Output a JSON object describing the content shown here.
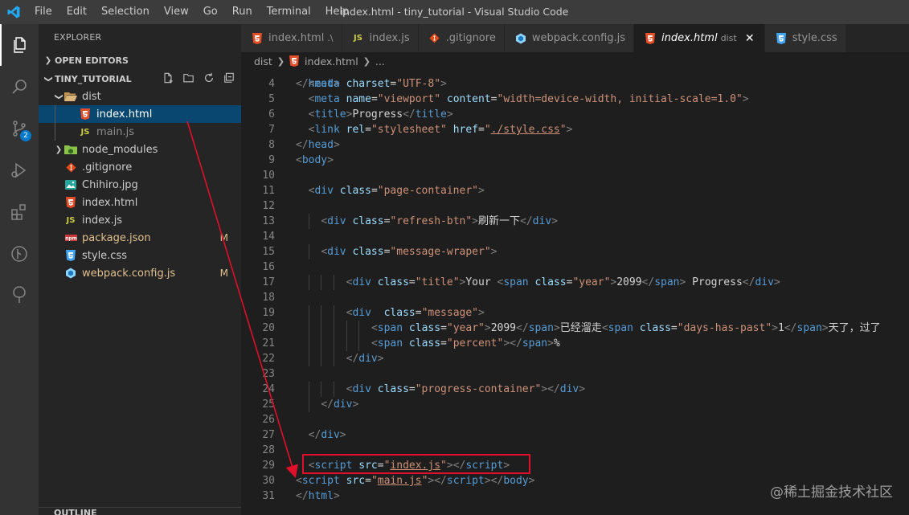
{
  "window_title": "index.html - tiny_tutorial - Visual Studio Code",
  "menu": [
    "File",
    "Edit",
    "Selection",
    "View",
    "Go",
    "Run",
    "Terminal",
    "Help"
  ],
  "activity_badge": "2",
  "sidebar": {
    "title": "EXPLORER",
    "open_editors": "OPEN EDITORS",
    "project": "TINY_TUTORIAL",
    "outline": "OUTLINE",
    "tree": [
      {
        "label": "dist",
        "type": "folder-open",
        "depth": 1
      },
      {
        "label": "index.html",
        "type": "html",
        "depth": 2,
        "selected": true
      },
      {
        "label": "main.js",
        "type": "js",
        "depth": 2,
        "dim": true
      },
      {
        "label": "node_modules",
        "type": "folder",
        "depth": 1
      },
      {
        "label": ".gitignore",
        "type": "git",
        "depth": 1
      },
      {
        "label": "Chihiro.jpg",
        "type": "image",
        "depth": 1
      },
      {
        "label": "index.html",
        "type": "html",
        "depth": 1
      },
      {
        "label": "index.js",
        "type": "js",
        "depth": 1
      },
      {
        "label": "package.json",
        "type": "json",
        "depth": 1,
        "modified": true,
        "status": "M"
      },
      {
        "label": "style.css",
        "type": "css",
        "depth": 1
      },
      {
        "label": "webpack.config.js",
        "type": "webpack",
        "depth": 1,
        "modified": true,
        "status": "M"
      }
    ]
  },
  "tabs": [
    {
      "label": "index.html",
      "desc": ".\\",
      "type": "html"
    },
    {
      "label": "index.js",
      "desc": "",
      "type": "js"
    },
    {
      "label": ".gitignore",
      "desc": "",
      "type": "git"
    },
    {
      "label": "webpack.config.js",
      "desc": "",
      "type": "webpack"
    },
    {
      "label": "index.html",
      "desc": "dist",
      "type": "html",
      "active": true
    },
    {
      "label": "style.css",
      "desc": "",
      "type": "css"
    }
  ],
  "breadcrumb": {
    "folder": "dist",
    "file": "index.html",
    "more": "..."
  },
  "editor": {
    "lines": [
      {
        "n": "4",
        "indent": 1,
        "tokens": [
          [
            "br",
            "<"
          ],
          [
            "tag",
            "meta"
          ],
          [
            "txt",
            " "
          ],
          [
            "attr",
            "charset"
          ],
          [
            "txt",
            "="
          ],
          [
            "str",
            "\"UTF-8\""
          ],
          [
            "br",
            ">"
          ]
        ]
      },
      {
        "n": "5",
        "indent": 1,
        "tokens": [
          [
            "br",
            "<"
          ],
          [
            "tag",
            "meta"
          ],
          [
            "txt",
            " "
          ],
          [
            "attr",
            "name"
          ],
          [
            "txt",
            "="
          ],
          [
            "str",
            "\"viewport\""
          ],
          [
            "txt",
            " "
          ],
          [
            "attr",
            "content"
          ],
          [
            "txt",
            "="
          ],
          [
            "str",
            "\"width=device-width, initial-scale=1.0\""
          ],
          [
            "br",
            ">"
          ]
        ]
      },
      {
        "n": "6",
        "indent": 1,
        "tokens": [
          [
            "br",
            "<"
          ],
          [
            "tag",
            "title"
          ],
          [
            "br",
            ">"
          ],
          [
            "txt",
            "Progress"
          ],
          [
            "br",
            "</"
          ],
          [
            "tag",
            "title"
          ],
          [
            "br",
            ">"
          ]
        ]
      },
      {
        "n": "7",
        "indent": 1,
        "tokens": [
          [
            "br",
            "<"
          ],
          [
            "tag",
            "link"
          ],
          [
            "txt",
            " "
          ],
          [
            "attr",
            "rel"
          ],
          [
            "txt",
            "="
          ],
          [
            "str",
            "\"stylesheet\""
          ],
          [
            "txt",
            " "
          ],
          [
            "attr",
            "href"
          ],
          [
            "txt",
            "="
          ],
          [
            "str",
            "\""
          ],
          [
            "strlink",
            "./style.css"
          ],
          [
            "str",
            "\""
          ],
          [
            "br",
            ">"
          ]
        ]
      },
      {
        "n": "8",
        "indent": 0,
        "tokens": [
          [
            "br",
            "</"
          ],
          [
            "tag",
            "head"
          ],
          [
            "br",
            ">"
          ]
        ]
      },
      {
        "n": "9",
        "indent": 0,
        "tokens": [
          [
            "br",
            "<"
          ],
          [
            "tag",
            "body"
          ],
          [
            "br",
            ">"
          ]
        ]
      },
      {
        "n": "10",
        "indent": 0,
        "tokens": []
      },
      {
        "n": "11",
        "indent": 1,
        "tokens": [
          [
            "br",
            "<"
          ],
          [
            "tag",
            "div"
          ],
          [
            "txt",
            " "
          ],
          [
            "attr",
            "class"
          ],
          [
            "txt",
            "="
          ],
          [
            "str",
            "\"page-container\""
          ],
          [
            "br",
            ">"
          ]
        ]
      },
      {
        "n": "12",
        "indent": 0,
        "tokens": []
      },
      {
        "n": "13",
        "indent": 2,
        "tokens": [
          [
            "br",
            "<"
          ],
          [
            "tag",
            "div"
          ],
          [
            "txt",
            " "
          ],
          [
            "attr",
            "class"
          ],
          [
            "txt",
            "="
          ],
          [
            "str",
            "\"refresh-btn\""
          ],
          [
            "br",
            ">"
          ],
          [
            "txt",
            "刷新一下"
          ],
          [
            "br",
            "</"
          ],
          [
            "tag",
            "div"
          ],
          [
            "br",
            ">"
          ]
        ]
      },
      {
        "n": "14",
        "indent": 0,
        "tokens": []
      },
      {
        "n": "15",
        "indent": 2,
        "tokens": [
          [
            "br",
            "<"
          ],
          [
            "tag",
            "div"
          ],
          [
            "txt",
            " "
          ],
          [
            "attr",
            "class"
          ],
          [
            "txt",
            "="
          ],
          [
            "str",
            "\"message-wraper\""
          ],
          [
            "br",
            ">"
          ]
        ]
      },
      {
        "n": "16",
        "indent": 0,
        "tokens": []
      },
      {
        "n": "17",
        "indent": 4,
        "tokens": [
          [
            "br",
            "<"
          ],
          [
            "tag",
            "div"
          ],
          [
            "txt",
            " "
          ],
          [
            "attr",
            "class"
          ],
          [
            "txt",
            "="
          ],
          [
            "str",
            "\"title\""
          ],
          [
            "br",
            ">"
          ],
          [
            "txt",
            "Your "
          ],
          [
            "br",
            "<"
          ],
          [
            "tag",
            "span"
          ],
          [
            "txt",
            " "
          ],
          [
            "attr",
            "class"
          ],
          [
            "txt",
            "="
          ],
          [
            "str",
            "\"year\""
          ],
          [
            "br",
            ">"
          ],
          [
            "txt",
            "2099"
          ],
          [
            "br",
            "</"
          ],
          [
            "tag",
            "span"
          ],
          [
            "br",
            ">"
          ],
          [
            "txt",
            " Progress"
          ],
          [
            "br",
            "</"
          ],
          [
            "tag",
            "div"
          ],
          [
            "br",
            ">"
          ]
        ]
      },
      {
        "n": "18",
        "indent": 0,
        "tokens": []
      },
      {
        "n": "19",
        "indent": 4,
        "tokens": [
          [
            "br",
            "<"
          ],
          [
            "tag",
            "div"
          ],
          [
            "txt",
            "  "
          ],
          [
            "attr",
            "class"
          ],
          [
            "txt",
            "="
          ],
          [
            "str",
            "\"message\""
          ],
          [
            "br",
            ">"
          ]
        ]
      },
      {
        "n": "20",
        "indent": 6,
        "tokens": [
          [
            "br",
            "<"
          ],
          [
            "tag",
            "span"
          ],
          [
            "txt",
            " "
          ],
          [
            "attr",
            "class"
          ],
          [
            "txt",
            "="
          ],
          [
            "str",
            "\"year\""
          ],
          [
            "br",
            ">"
          ],
          [
            "txt",
            "2099"
          ],
          [
            "br",
            "</"
          ],
          [
            "tag",
            "span"
          ],
          [
            "br",
            ">"
          ],
          [
            "txt",
            "已经溜走"
          ],
          [
            "br",
            "<"
          ],
          [
            "tag",
            "span"
          ],
          [
            "txt",
            " "
          ],
          [
            "attr",
            "class"
          ],
          [
            "txt",
            "="
          ],
          [
            "str",
            "\"days-has-past\""
          ],
          [
            "br",
            ">"
          ],
          [
            "txt",
            "1"
          ],
          [
            "br",
            "</"
          ],
          [
            "tag",
            "span"
          ],
          [
            "br",
            ">"
          ],
          [
            "txt",
            "天了，过了"
          ]
        ]
      },
      {
        "n": "21",
        "indent": 6,
        "tokens": [
          [
            "br",
            "<"
          ],
          [
            "tag",
            "span"
          ],
          [
            "txt",
            " "
          ],
          [
            "attr",
            "class"
          ],
          [
            "txt",
            "="
          ],
          [
            "str",
            "\"percent\""
          ],
          [
            "br",
            "></"
          ],
          [
            "tag",
            "span"
          ],
          [
            "br",
            ">"
          ],
          [
            "txt",
            "%"
          ]
        ]
      },
      {
        "n": "22",
        "indent": 4,
        "tokens": [
          [
            "br",
            "</"
          ],
          [
            "tag",
            "div"
          ],
          [
            "br",
            ">"
          ]
        ]
      },
      {
        "n": "23",
        "indent": 0,
        "tokens": []
      },
      {
        "n": "24",
        "indent": 4,
        "tokens": [
          [
            "br",
            "<"
          ],
          [
            "tag",
            "div"
          ],
          [
            "txt",
            " "
          ],
          [
            "attr",
            "class"
          ],
          [
            "txt",
            "="
          ],
          [
            "str",
            "\"progress-container\""
          ],
          [
            "br",
            "></"
          ],
          [
            "tag",
            "div"
          ],
          [
            "br",
            ">"
          ]
        ]
      },
      {
        "n": "25",
        "indent": 2,
        "tokens": [
          [
            "br",
            "</"
          ],
          [
            "tag",
            "div"
          ],
          [
            "br",
            ">"
          ]
        ]
      },
      {
        "n": "26",
        "indent": 0,
        "tokens": []
      },
      {
        "n": "27",
        "indent": 1,
        "tokens": [
          [
            "br",
            "</"
          ],
          [
            "tag",
            "div"
          ],
          [
            "br",
            ">"
          ]
        ]
      },
      {
        "n": "28",
        "indent": 0,
        "tokens": []
      },
      {
        "n": "29",
        "indent": 1,
        "tokens": [
          [
            "br",
            "<"
          ],
          [
            "tag",
            "script"
          ],
          [
            "txt",
            " "
          ],
          [
            "attr",
            "src"
          ],
          [
            "txt",
            "="
          ],
          [
            "str",
            "\""
          ],
          [
            "strlink",
            "index.js"
          ],
          [
            "str",
            "\""
          ],
          [
            "br",
            "></"
          ],
          [
            "tag",
            "script"
          ],
          [
            "br",
            ">"
          ]
        ]
      },
      {
        "n": "30",
        "indent": 0,
        "tokens": [
          [
            "br",
            "<"
          ],
          [
            "tag",
            "script"
          ],
          [
            "txt",
            " "
          ],
          [
            "attr",
            "src"
          ],
          [
            "txt",
            "="
          ],
          [
            "str",
            "\""
          ],
          [
            "strlink",
            "main.js"
          ],
          [
            "str",
            "\""
          ],
          [
            "br",
            "></"
          ],
          [
            "tag",
            "script"
          ],
          [
            "br",
            "></"
          ],
          [
            "tag",
            "body"
          ],
          [
            "br",
            ">"
          ]
        ]
      },
      {
        "n": "31",
        "indent": 0,
        "tokens": [
          [
            "br",
            "</"
          ],
          [
            "tag",
            "html"
          ],
          [
            "br",
            ">"
          ]
        ]
      }
    ]
  },
  "watermark": "@稀土掘金技术社区",
  "colors": {
    "accent": "#007acc",
    "selection": "#094771",
    "annotation": "#e0102a",
    "modified": "#e2c08d"
  }
}
